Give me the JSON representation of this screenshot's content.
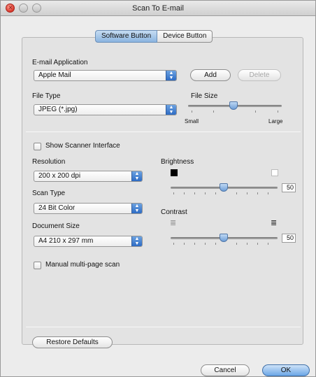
{
  "window": {
    "title": "Scan To E-mail"
  },
  "tabs": [
    {
      "label": "Software Button",
      "active": true
    },
    {
      "label": "Device Button",
      "active": false
    }
  ],
  "email": {
    "label": "E-mail Application",
    "value": "Apple Mail",
    "add_label": "Add",
    "delete_label": "Delete"
  },
  "file_type": {
    "label": "File Type",
    "value": "JPEG (*.jpg)"
  },
  "file_size": {
    "label": "File Size",
    "min_label": "Small",
    "max_label": "Large",
    "level": 0.45
  },
  "show_scanner": {
    "label": "Show Scanner Interface",
    "checked": false
  },
  "resolution": {
    "label": "Resolution",
    "value": "200 x 200 dpi"
  },
  "scan_type": {
    "label": "Scan Type",
    "value": "24 Bit Color"
  },
  "document_size": {
    "label": "Document Size",
    "value": "A4  210 x 297 mm"
  },
  "brightness": {
    "label": "Brightness",
    "value": "50",
    "level": 0.5
  },
  "contrast": {
    "label": "Contrast",
    "value": "50",
    "level": 0.5
  },
  "manual_multipage": {
    "label": "Manual multi-page scan",
    "checked": false
  },
  "buttons": {
    "restore_label": "Restore Defaults",
    "cancel_label": "Cancel",
    "ok_label": "OK"
  },
  "icons": {
    "close": "close-icon",
    "minimize": "minimize-icon",
    "zoom": "zoom-icon",
    "popup_arrows": "up-down-arrows-icon",
    "brightness_dark": "black-square-icon",
    "brightness_light": "white-square-icon",
    "contrast_low": "low-contrast-icon",
    "contrast_high": "high-contrast-icon"
  },
  "colors": {
    "accent": "#5e9ae0",
    "window": "#ececec",
    "panel": "#e3e3e3"
  }
}
